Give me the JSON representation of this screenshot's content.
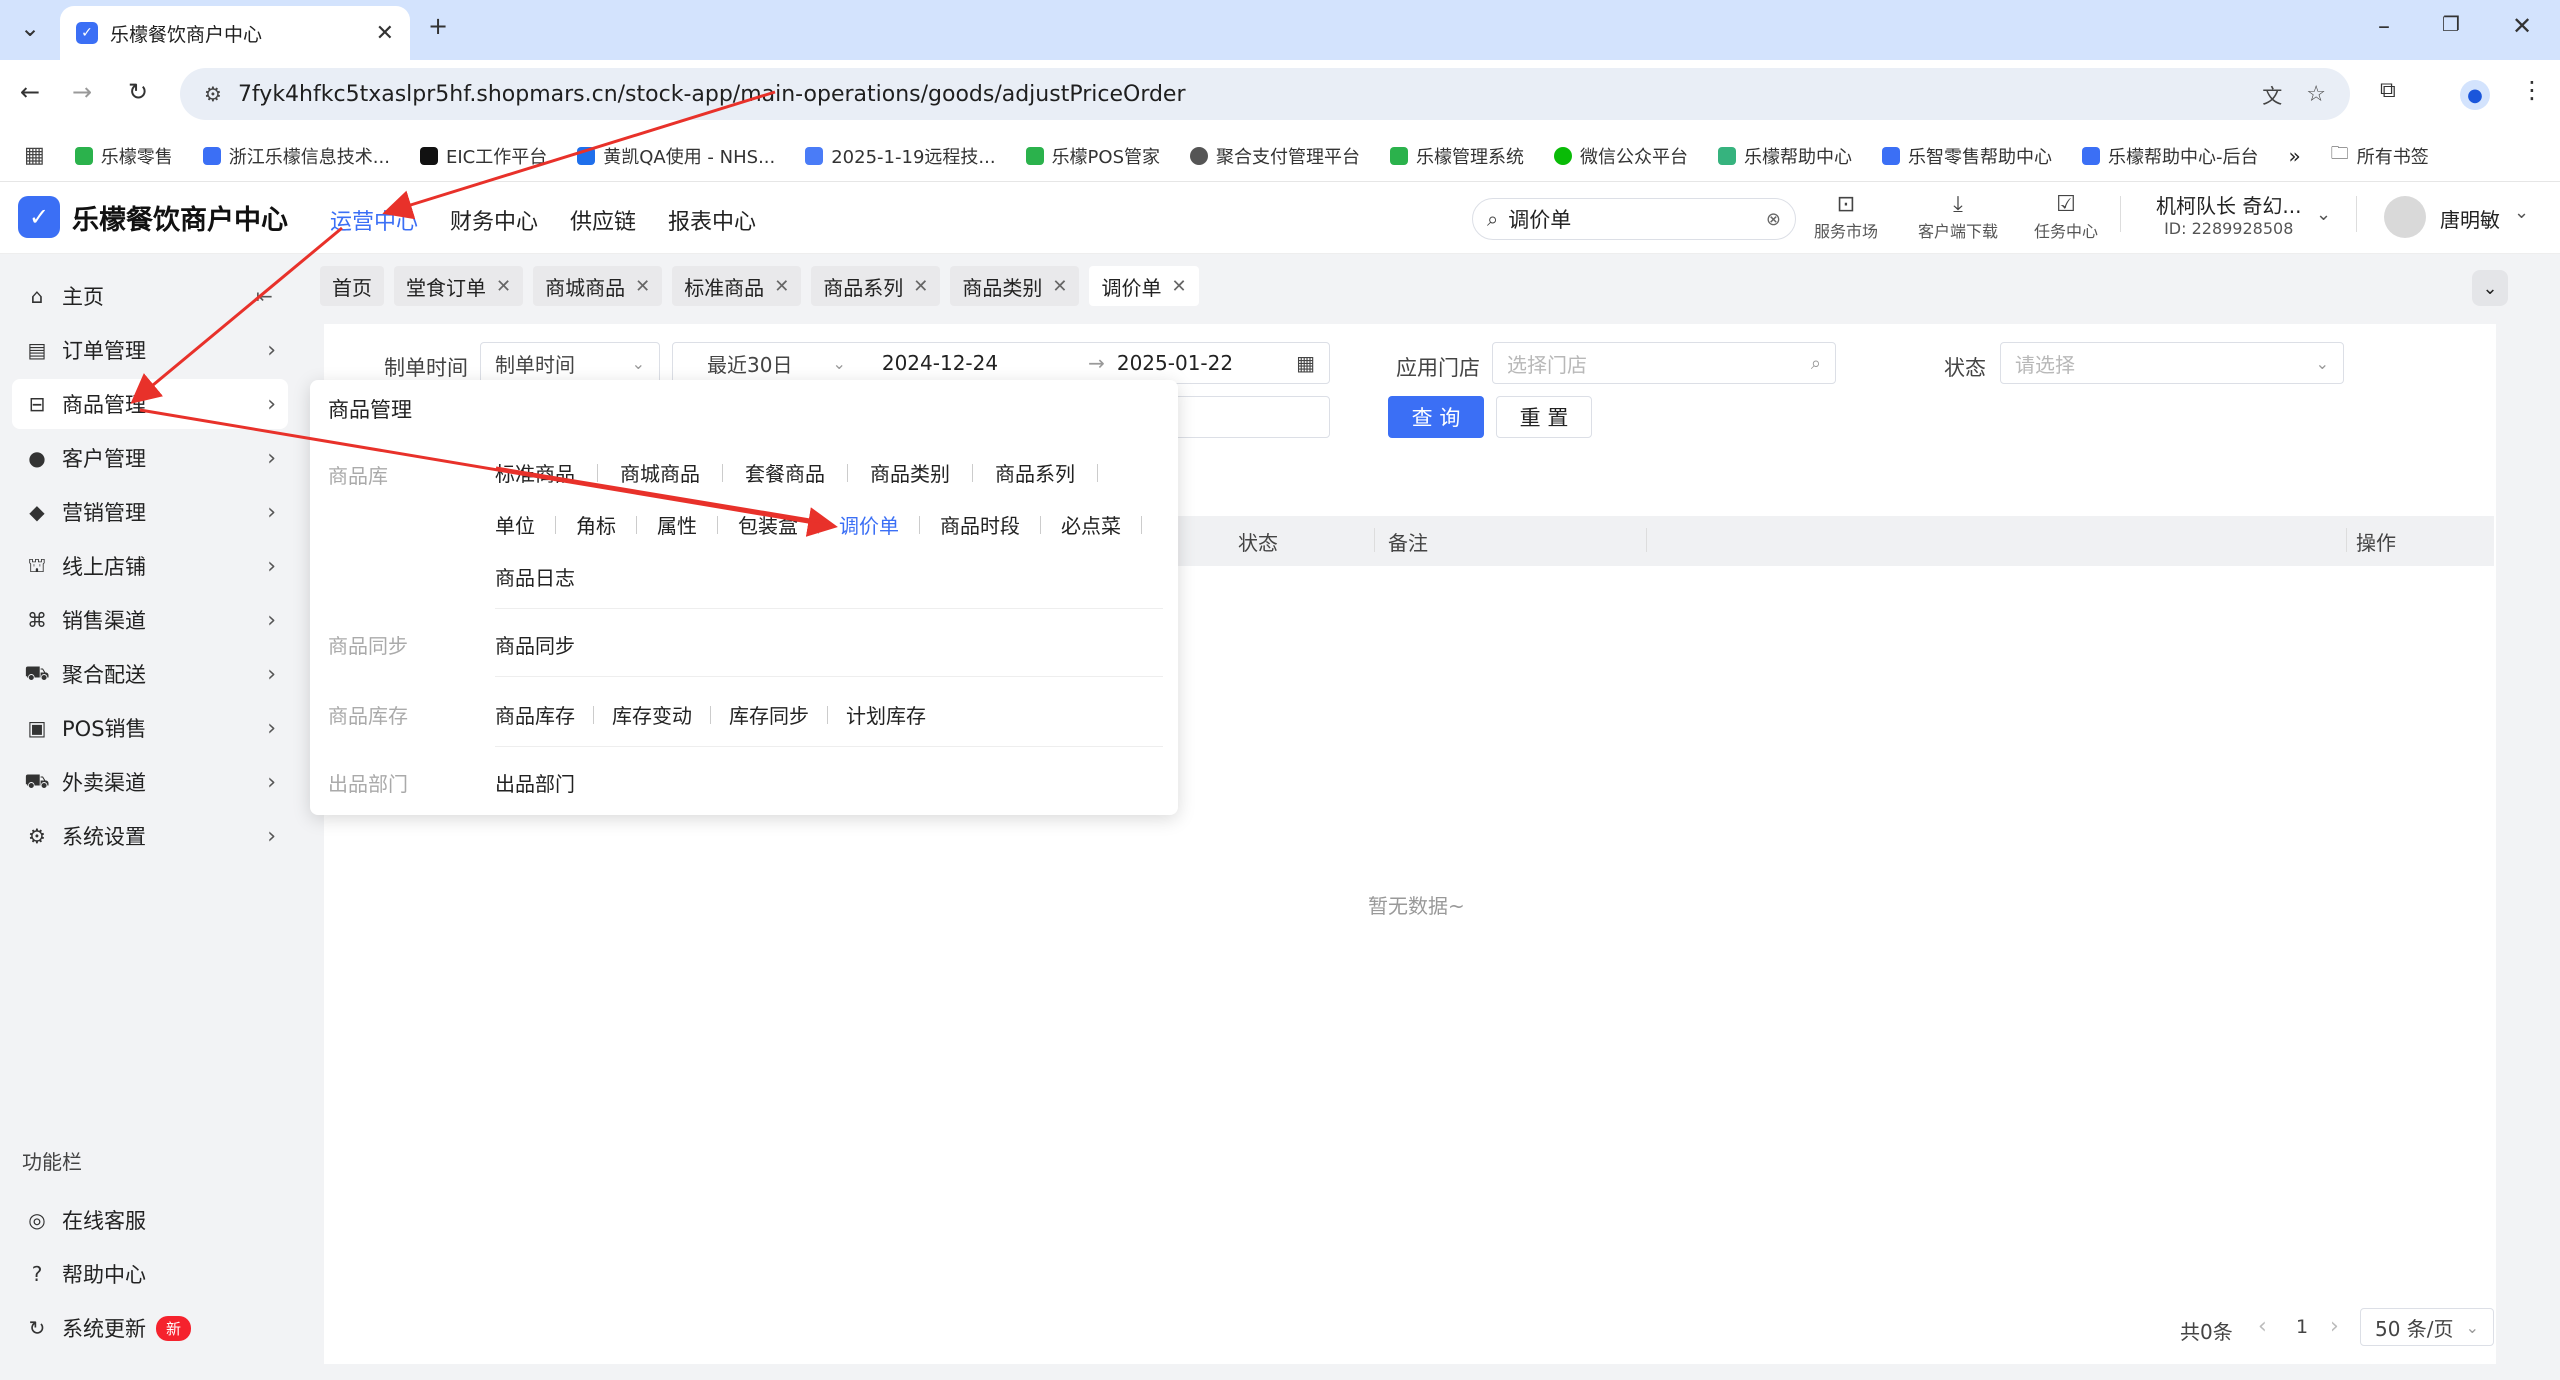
{
  "browser": {
    "tab_title": "乐檬餐饮商户中心",
    "url": "7fyk4hfkc5txaslpr5hf.shopmars.cn/stock-app/main-operations/goods/adjustPriceOrder",
    "bookmarks": [
      "乐檬零售",
      "浙江乐檬信息技术...",
      "EIC工作平台",
      "黄凯QA使用 - NHS...",
      "2025-1-19远程技...",
      "乐檬POS管家",
      "聚合支付管理平台",
      "乐檬管理系统",
      "微信公众平台",
      "乐檬帮助中心",
      "乐智零售帮助中心",
      "乐檬帮助中心-后台"
    ],
    "all_bookmarks": "所有书签"
  },
  "app": {
    "logo_text": "乐檬餐饮商户中心",
    "topnav": [
      "运营中心",
      "财务中心",
      "供应链",
      "报表中心"
    ],
    "search_value": "调价单",
    "header_icons": [
      "服务市场",
      "客户端下载",
      "任务中心"
    ],
    "account_name": "机柯队长 奇幻...",
    "account_id": "ID: 2289928508",
    "user_name": "唐明敏"
  },
  "sidebar": {
    "items": [
      "主页",
      "订单管理",
      "商品管理",
      "客户管理",
      "营销管理",
      "线上店铺",
      "销售渠道",
      "聚合配送",
      "POS销售",
      "外卖渠道",
      "系统设置"
    ],
    "func_title": "功能栏",
    "func_items": [
      "在线客服",
      "帮助中心",
      "系统更新"
    ],
    "new_badge": "新"
  },
  "tags": [
    "首页",
    "堂食订单",
    "商城商品",
    "标准商品",
    "商品系列",
    "商品类别",
    "调价单"
  ],
  "filters": {
    "date_label": "制单时间",
    "date_type": "制单时间",
    "date_range": "最近30日",
    "start_date": "2024-12-24",
    "end_date": "2025-01-22",
    "store_label": "应用门店",
    "store_placeholder": "选择门店",
    "status_label": "状态",
    "status_placeholder": "请选择",
    "query": "查 询",
    "reset": "重 置"
  },
  "table": {
    "headers": [
      "状态",
      "备注",
      "操作"
    ],
    "empty": "暂无数据~"
  },
  "pagination": {
    "total": "共0条",
    "page": "1",
    "page_size": "50 条/页"
  },
  "menu": {
    "title": "商品管理",
    "sections": [
      {
        "cat": "商品库",
        "rows": [
          [
            "标准商品",
            "商城商品",
            "套餐商品",
            "商品类别",
            "商品系列"
          ],
          [
            "单位",
            "角标",
            "属性",
            "包装盒",
            "调价单",
            "商品时段",
            "必点菜"
          ],
          [
            "商品日志"
          ]
        ]
      },
      {
        "cat": "商品同步",
        "rows": [
          [
            "商品同步"
          ]
        ]
      },
      {
        "cat": "商品库存",
        "rows": [
          [
            "商品库存",
            "库存变动",
            "库存同步",
            "计划库存"
          ]
        ]
      },
      {
        "cat": "出品部门",
        "rows": [
          [
            "出品部门"
          ]
        ]
      }
    ],
    "active_item": "调价单"
  },
  "colors": {
    "accent": "#3b6ff5",
    "annotation": "#e8312a"
  }
}
